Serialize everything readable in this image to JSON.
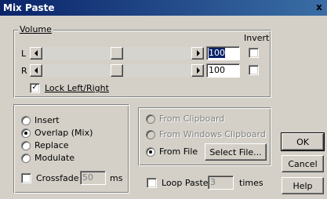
{
  "window": {
    "title": "Mix Paste",
    "close_label": "x"
  },
  "volume": {
    "group_label_prefix": "",
    "group_label": "Volume",
    "invert_label": "Invert",
    "left": {
      "label": "L",
      "value": "100",
      "level": 0.5,
      "inverted": false
    },
    "right": {
      "label": "R",
      "value": "100",
      "level": 0.5,
      "inverted": false
    },
    "lock_label": "Lock Left/Right",
    "lock_checked": true
  },
  "mode": {
    "options": [
      {
        "label": "Insert",
        "selected": false
      },
      {
        "label": "Overlap (Mix)",
        "selected": true
      },
      {
        "label": "Replace",
        "selected": false
      },
      {
        "label": "Modulate",
        "selected": false
      }
    ],
    "crossfade_label": "Crossfade",
    "crossfade_checked": false,
    "crossfade_value": "50",
    "crossfade_unit": "ms"
  },
  "source": {
    "from_clipboard": "From Clipboard",
    "from_windows_clipboard": "From Windows Clipboard",
    "from_file": "From File",
    "select_file_button": "Select File...",
    "selected": "from_file"
  },
  "loop": {
    "label": "Loop Paste",
    "checked": false,
    "value": "3",
    "unit": "times"
  },
  "buttons": {
    "ok": "OK",
    "cancel": "Cancel",
    "help": "Help"
  }
}
